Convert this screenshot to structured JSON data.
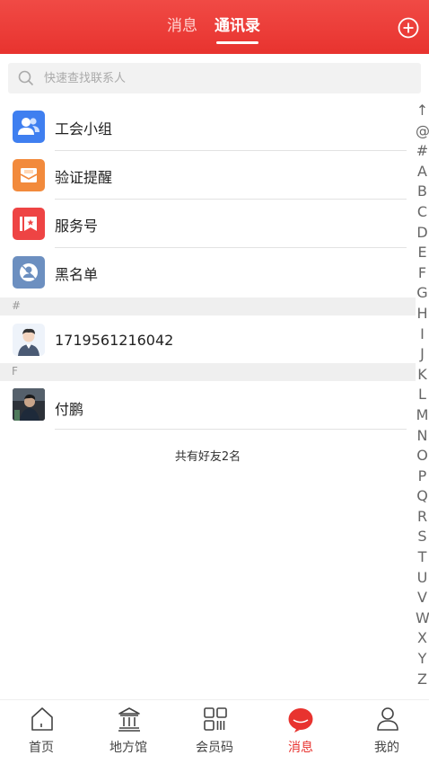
{
  "header": {
    "tabs": [
      {
        "label": "消息",
        "active": false
      },
      {
        "label": "通讯录",
        "active": true
      }
    ],
    "bg_color": "#e8332f",
    "add_icon": "plus-circle-icon"
  },
  "search": {
    "placeholder": "快速查找联系人",
    "icon": "search-icon"
  },
  "groups": [
    {
      "label": "工会小组",
      "icon": "people-icon",
      "color": "#3f7ff0"
    },
    {
      "label": "验证提醒",
      "icon": "envelope-icon",
      "color": "#f28a3c"
    },
    {
      "label": "服务号",
      "icon": "bookmark-icon",
      "color": "#ee4444"
    },
    {
      "label": "黑名单",
      "icon": "user-blocked-icon",
      "color": "#6c8fc0"
    }
  ],
  "sections": [
    {
      "letter": "#",
      "contacts": [
        {
          "name": "1719561216042",
          "avatar": "default-avatar"
        }
      ]
    },
    {
      "letter": "F",
      "contacts": [
        {
          "name": "付鹏",
          "avatar": "photo-avatar"
        }
      ]
    }
  ],
  "friends_count": "共有好友2名",
  "alphabet_index": [
    "↑",
    "@",
    "#",
    "A",
    "B",
    "C",
    "D",
    "E",
    "F",
    "G",
    "H",
    "I",
    "J",
    "K",
    "L",
    "M",
    "N",
    "O",
    "P",
    "Q",
    "R",
    "S",
    "T",
    "U",
    "V",
    "W",
    "X",
    "Y",
    "Z"
  ],
  "bottom_nav": [
    {
      "label": "首页",
      "icon": "home-icon",
      "active": false
    },
    {
      "label": "地方馆",
      "icon": "museum-icon",
      "active": false
    },
    {
      "label": "会员码",
      "icon": "qrcode-icon",
      "active": false
    },
    {
      "label": "消息",
      "icon": "message-icon",
      "active": true
    },
    {
      "label": "我的",
      "icon": "user-icon",
      "active": false
    }
  ],
  "accent_color": "#e8332f"
}
